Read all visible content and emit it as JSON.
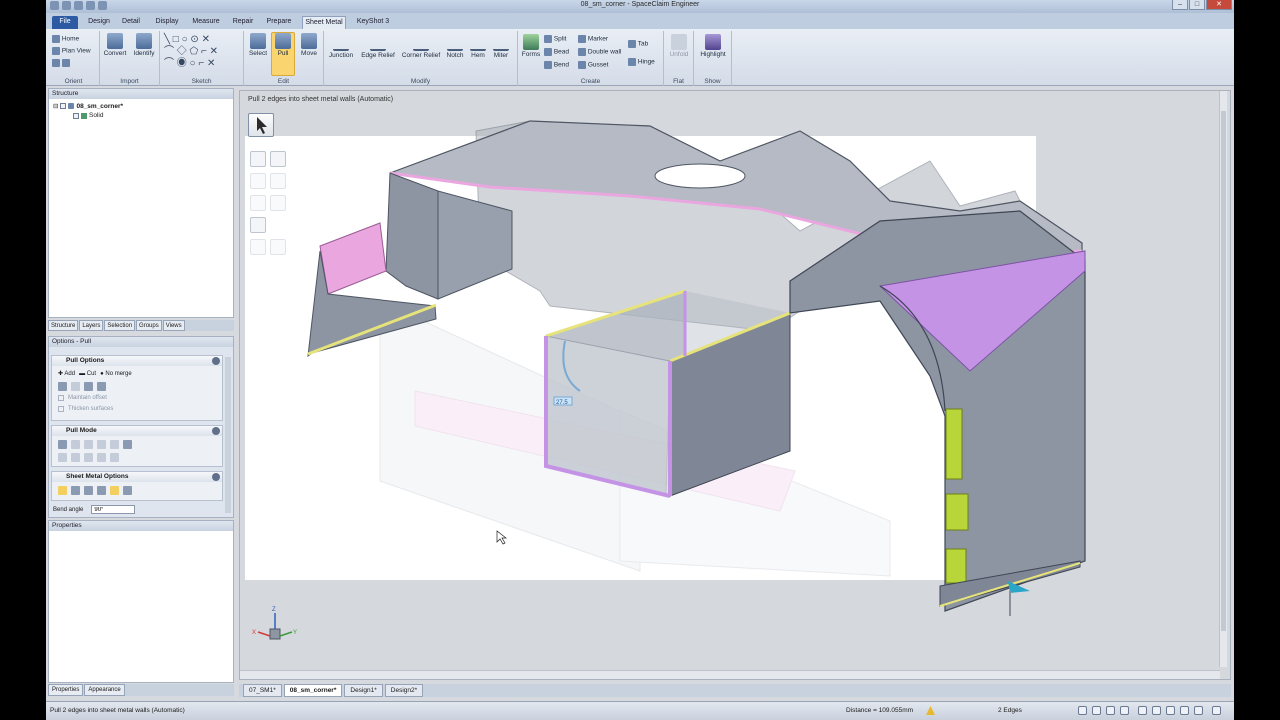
{
  "window": {
    "title": "08_sm_corner - SpaceClaim Engineer",
    "buttons": [
      "–",
      "□",
      "✕"
    ]
  },
  "tabs": [
    "File",
    "Design",
    "Detail",
    "Display",
    "Measure",
    "Repair",
    "Prepare",
    "Sheet Metal",
    "KeyShot 3"
  ],
  "active_tab": "Sheet Metal",
  "ribbon": {
    "orient": {
      "label": "Orient",
      "home": "Home",
      "plan_view": "Plan View"
    },
    "import": {
      "label": "Import",
      "convert": "Convert",
      "identify": "Identify"
    },
    "sketch": {
      "label": "Sketch"
    },
    "edit": {
      "label": "Edit",
      "select": "Select",
      "pull": "Pull",
      "move": "Move"
    },
    "modify": {
      "label": "Modify",
      "junction": "Junction",
      "edge_relief": "Edge Relief",
      "corner_relief": "Corner Relief",
      "notch": "Notch",
      "hem": "Hem",
      "miter": "Miter"
    },
    "create": {
      "label": "Create",
      "forms": "Forms",
      "split": "Split",
      "marker": "Marker",
      "bead": "Bead",
      "double_wall": "Double wall",
      "bend": "Bend",
      "gusset": "Gusset",
      "tab": "Tab",
      "hinge": "Hinge"
    },
    "flat": {
      "label": "Flat",
      "unfold": "Unfold"
    },
    "show": {
      "label": "Show",
      "highlight": "Highlight"
    }
  },
  "structure": {
    "header": "Structure",
    "root": "08_sm_corner*",
    "child": "Solid"
  },
  "panel_tabs": [
    "Structure",
    "Layers",
    "Selection",
    "Groups",
    "Views"
  ],
  "options": {
    "header": "Options - Pull",
    "pull_options": {
      "title": "Pull Options",
      "add": "Add",
      "cut": "Cut",
      "no_merge": "No merge",
      "maintain_offset": "Maintain offset",
      "thicken_surfaces": "Thicken surfaces"
    },
    "pull_mode": {
      "title": "Pull Mode"
    },
    "sheet_metal_options": {
      "title": "Sheet Metal Options"
    },
    "bend_angle_label": "Bend angle",
    "bend_angle_value": "90°"
  },
  "properties": {
    "header": "Properties"
  },
  "left_bottom_tabs": [
    "Properties",
    "Appearance"
  ],
  "viewport": {
    "status": "Pull 2 edges into sheet metal walls (Automatic)",
    "dimension_value": "27.5",
    "triad": {
      "z": "Z",
      "x": "X",
      "y": "Y"
    }
  },
  "doc_tabs": [
    "07_SM1*",
    "08_sm_corner*",
    "Design1*",
    "Design2*"
  ],
  "active_doc": "08_sm_corner*",
  "statusbar": {
    "message": "Pull 2 edges into sheet metal walls (Automatic)",
    "distance": "Distance = 109.055mm",
    "selection": "2 Edges"
  },
  "colors": {
    "pink_face": "#e9a6df",
    "purple_face": "#c493e6",
    "yellow_edge": "#e6e37a",
    "green_tabs": "#b8d63a",
    "gray_face": "#8d95a3",
    "file_tab": "#2c5aa3"
  }
}
